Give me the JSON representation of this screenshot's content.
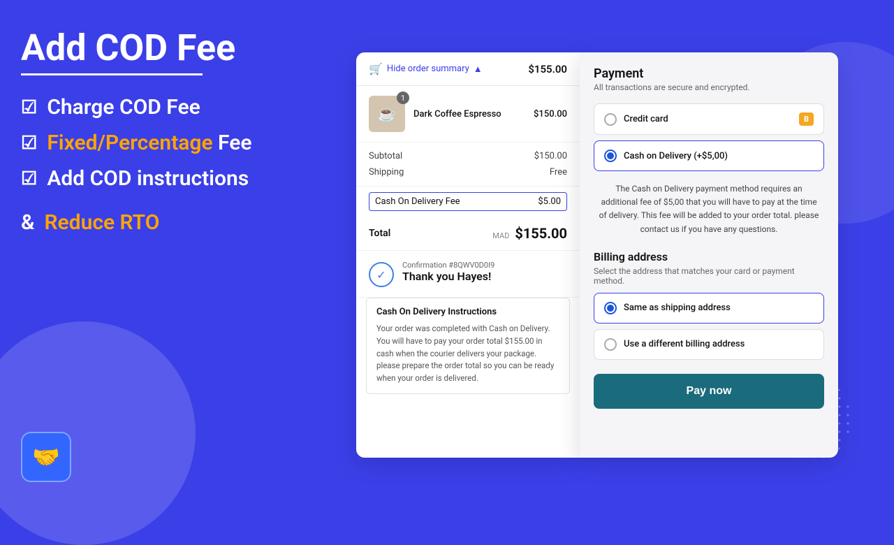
{
  "background": {
    "color": "#3b3fe8"
  },
  "left_panel": {
    "title": "Add COD Fee",
    "features": [
      {
        "id": "charge",
        "text": "Charge COD Fee"
      },
      {
        "id": "fixed",
        "text_normal": "",
        "text_highlight": "Fixed/Percentage",
        "text_after": " Fee"
      },
      {
        "id": "instructions",
        "text": "Add COD instructions"
      }
    ],
    "reduce_label_prefix": "& ",
    "reduce_label_highlight": "Reduce RTO"
  },
  "order_summary": {
    "toggle_label": "Hide order summary",
    "total_header": "$155.00",
    "product": {
      "name": "Dark Coffee Espresso",
      "price": "$150.00",
      "quantity": "1",
      "emoji": "☕"
    },
    "lines": [
      {
        "label": "Subtotal",
        "value": "$150.00"
      },
      {
        "label": "Shipping",
        "value": "Free"
      }
    ],
    "cod_fee": {
      "label": "Cash On Delivery Fee",
      "value": "$5.00"
    },
    "total": {
      "label": "Total",
      "currency": "MAD",
      "amount": "$155.00"
    },
    "confirmation": {
      "number": "Confirmation #8QWV0D0I9",
      "thanks": "Thank you Hayes!"
    },
    "cod_instructions": {
      "title": "Cash On Delivery Instructions",
      "body": "Your order was completed with Cash on Delivery. You will have to pay your order total $155.00 in cash when the courier delivers your package. please prepare the order total so you can be ready when your order is delivered."
    }
  },
  "payment": {
    "title": "Payment",
    "subtitle": "All transactions are secure and encrypted.",
    "methods": [
      {
        "id": "credit_card",
        "label": "Credit card",
        "selected": false,
        "badge": "B"
      },
      {
        "id": "cod",
        "label": "Cash on Delivery (+$5,00)",
        "selected": true,
        "description": "The Cash on Delivery payment method requires an additional fee of $5,00 that you will have to pay at the time of delivery. This fee will be added to your order total. please contact us if you have any questions."
      }
    ],
    "billing": {
      "title": "Billing address",
      "subtitle": "Select the address that matches your card or payment method.",
      "options": [
        {
          "id": "same",
          "label": "Same as shipping address",
          "selected": true
        },
        {
          "id": "different",
          "label": "Use a different billing address",
          "selected": false
        }
      ]
    },
    "pay_button": "Pay now"
  }
}
